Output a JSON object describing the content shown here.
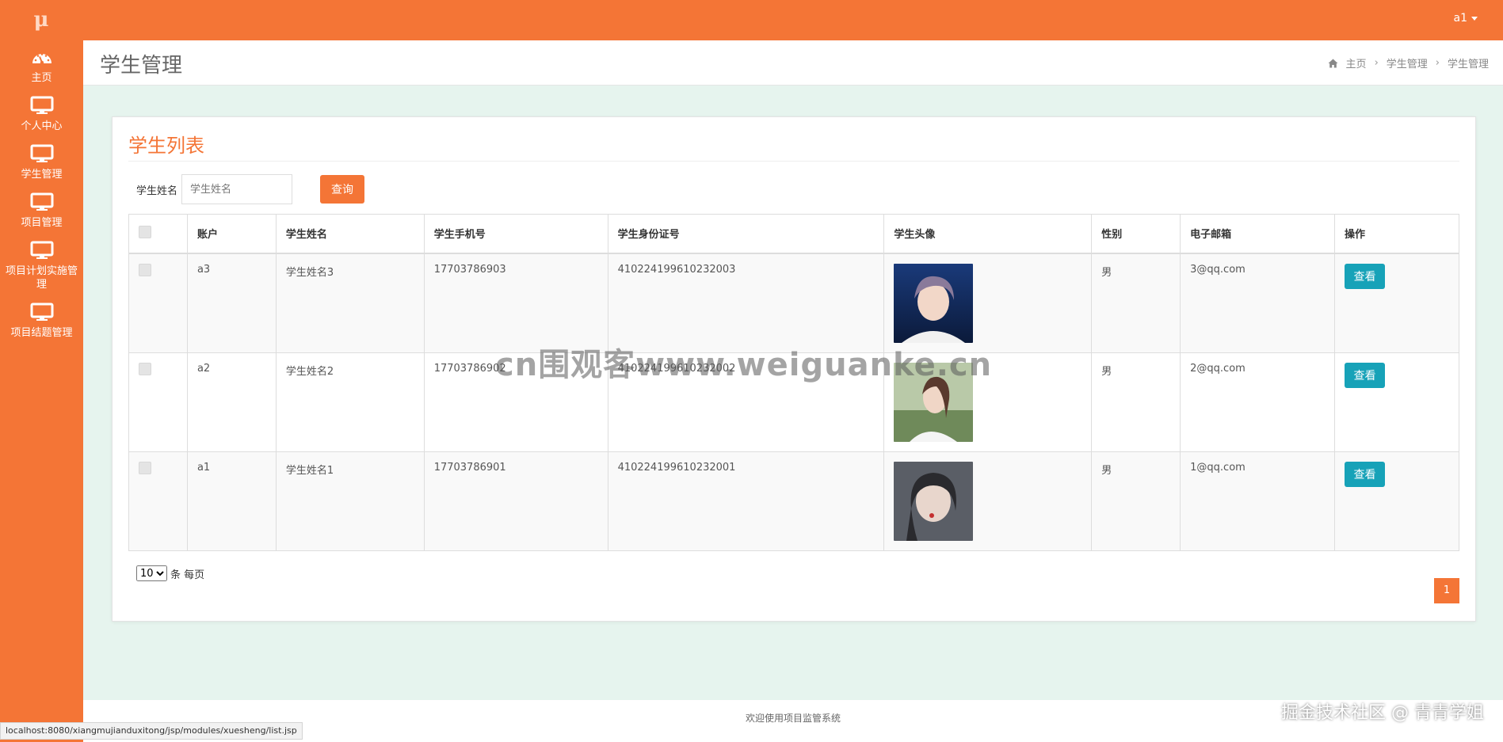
{
  "app": {
    "logo_text": "μ",
    "user": "a1"
  },
  "sidebar": {
    "items": [
      {
        "label": "主页",
        "icon": "dashboard-icon"
      },
      {
        "label": "个人中心",
        "icon": "monitor-icon"
      },
      {
        "label": "学生管理",
        "icon": "monitor-icon"
      },
      {
        "label": "项目管理",
        "icon": "monitor-icon"
      },
      {
        "label": "项目计划实施管理",
        "icon": "monitor-icon"
      },
      {
        "label": "项目结题管理",
        "icon": "monitor-icon"
      }
    ]
  },
  "header": {
    "title": "学生管理",
    "breadcrumb": [
      "主页",
      "学生管理",
      "学生管理"
    ]
  },
  "panel": {
    "title": "学生列表",
    "search": {
      "label": "学生姓名",
      "placeholder": "学生姓名",
      "button": "查询"
    },
    "table": {
      "columns": [
        "账户",
        "学生姓名",
        "学生手机号",
        "学生身份证号",
        "学生头像",
        "性别",
        "电子邮箱",
        "操作"
      ],
      "rows": [
        {
          "account": "a3",
          "name": "学生姓名3",
          "phone": "17703786903",
          "id_number": "410224199610232003",
          "gender": "男",
          "email": "3@qq.com",
          "action": "查看"
        },
        {
          "account": "a2",
          "name": "学生姓名2",
          "phone": "17703786902",
          "id_number": "410224199610232002",
          "gender": "男",
          "email": "2@qq.com",
          "action": "查看"
        },
        {
          "account": "a1",
          "name": "学生姓名1",
          "phone": "17703786901",
          "id_number": "410224199610232001",
          "gender": "男",
          "email": "1@qq.com",
          "action": "查看"
        }
      ]
    },
    "pagination": {
      "page_size": "10",
      "page_size_suffix": "条 每页",
      "current_page": "1"
    }
  },
  "footer": {
    "text": "欢迎使用项目监管系统"
  },
  "statusbar": {
    "url": "localhost:8080/xiangmujianduxitong/jsp/modules/xuesheng/list.jsp"
  },
  "watermarks": {
    "center": "cn围观客www.weiguanke.cn",
    "corner": "掘金技术社区 @ 青青学姐"
  },
  "colors": {
    "accent": "#f47536",
    "view_button": "#17a2b8",
    "content_bg": "#e6f4ee"
  }
}
